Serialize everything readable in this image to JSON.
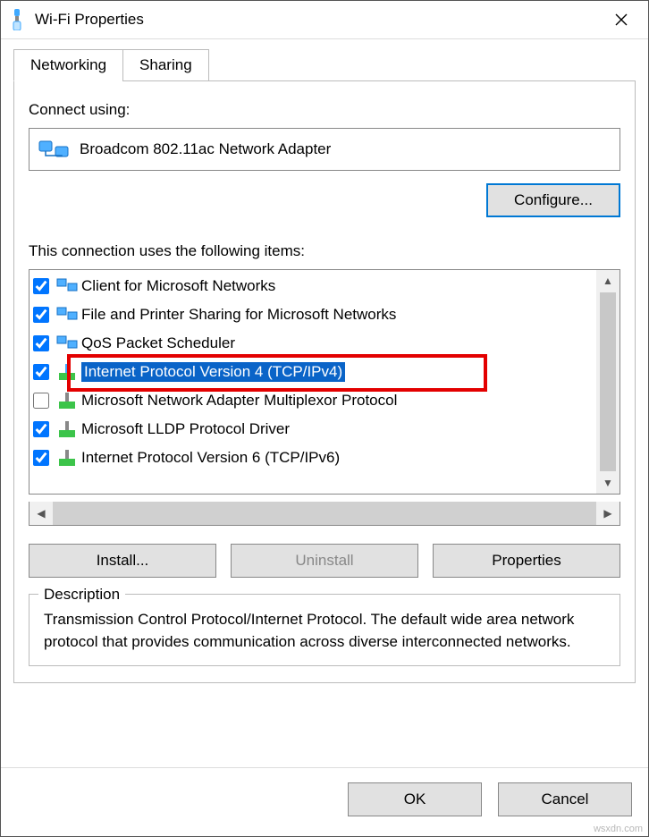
{
  "window": {
    "title": "Wi-Fi Properties"
  },
  "tabs": {
    "networking": "Networking",
    "sharing": "Sharing"
  },
  "connect_label": "Connect using:",
  "adapter": "Broadcom 802.11ac Network Adapter",
  "configure_btn": "Configure...",
  "items_label": "This connection uses the following items:",
  "items": [
    {
      "checked": true,
      "label": "Client for Microsoft Networks"
    },
    {
      "checked": true,
      "label": "File and Printer Sharing for Microsoft Networks"
    },
    {
      "checked": true,
      "label": "QoS Packet Scheduler"
    },
    {
      "checked": true,
      "label": "Internet Protocol Version 4 (TCP/IPv4)"
    },
    {
      "checked": false,
      "label": "Microsoft Network Adapter Multiplexor Protocol"
    },
    {
      "checked": true,
      "label": "Microsoft LLDP Protocol Driver"
    },
    {
      "checked": true,
      "label": "Internet Protocol Version 6 (TCP/IPv6)"
    }
  ],
  "buttons": {
    "install": "Install...",
    "uninstall": "Uninstall",
    "properties": "Properties"
  },
  "description": {
    "legend": "Description",
    "text": "Transmission Control Protocol/Internet Protocol. The default wide area network protocol that provides communication across diverse interconnected networks."
  },
  "footer": {
    "ok": "OK",
    "cancel": "Cancel"
  },
  "watermark": "wsxdn.com"
}
